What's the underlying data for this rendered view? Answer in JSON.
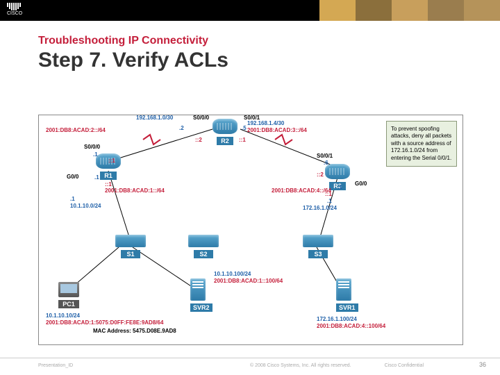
{
  "header": {
    "subtitle": "Troubleshooting IP Connectivity",
    "title": "Step 7. Verify ACLs"
  },
  "callout": "To prevent spoofing attacks, deny all packets with a source address of 172.16.1.0/24 from entering the Serial 0/0/1.",
  "devices": {
    "r1": "R1",
    "r2": "R2",
    "r3": "R3",
    "s1": "S1",
    "s2": "S2",
    "s3": "S3",
    "pc1": "PC1",
    "svr1": "SVR1",
    "svr2": "SVR2"
  },
  "labels": {
    "r2_s000": "S0/0/0",
    "r2_s001": "S0/0/1",
    "net_l_v4": "192.168.1.0/30",
    "net_l_v6": "2001:DB8:ACAD:2::/64",
    "net_r_v4": "192.168.1.4/30",
    "net_r_v6": "2001:DB8:ACAD:3::/64",
    "r1_s000": "S0/0/0",
    "r1_g00": "G0/0",
    "r3_s001": "S0/0/1",
    "r3_g00": "G0/0",
    "p1": ".1",
    "p2": ".2",
    "p5": ".5",
    "p6": ".6",
    "c1": "::1",
    "c2": "::2",
    "r1_lan_v6": "2001:DB8:ACAD:1::/64",
    "r1_lan_v4": "10.1.10.0/24",
    "r3_lan_v6": "2001:DB8:ACAD:4::/64",
    "r3_lan_v4": "172.16.1.0/24",
    "svr2_v4": "10.1.10.100/24",
    "svr2_v6": "2001:DB8:ACAD:1::100/64",
    "pc1_v4": "10.1.10.10/24",
    "pc1_v6": "2001:DB8:ACAD:1:5075:D0FF:FE8E:9AD8/64",
    "mac": "MAC Address: 5475.D08E.9AD8",
    "svr1_v4": "172.16.1.100/24",
    "svr1_v6": "2001:DB8:ACAD:4::100/64"
  },
  "footer": {
    "left": "Presentation_ID",
    "center": "© 2008 Cisco Systems, Inc. All rights reserved.",
    "right": "Cisco Confidential",
    "page": "36"
  }
}
